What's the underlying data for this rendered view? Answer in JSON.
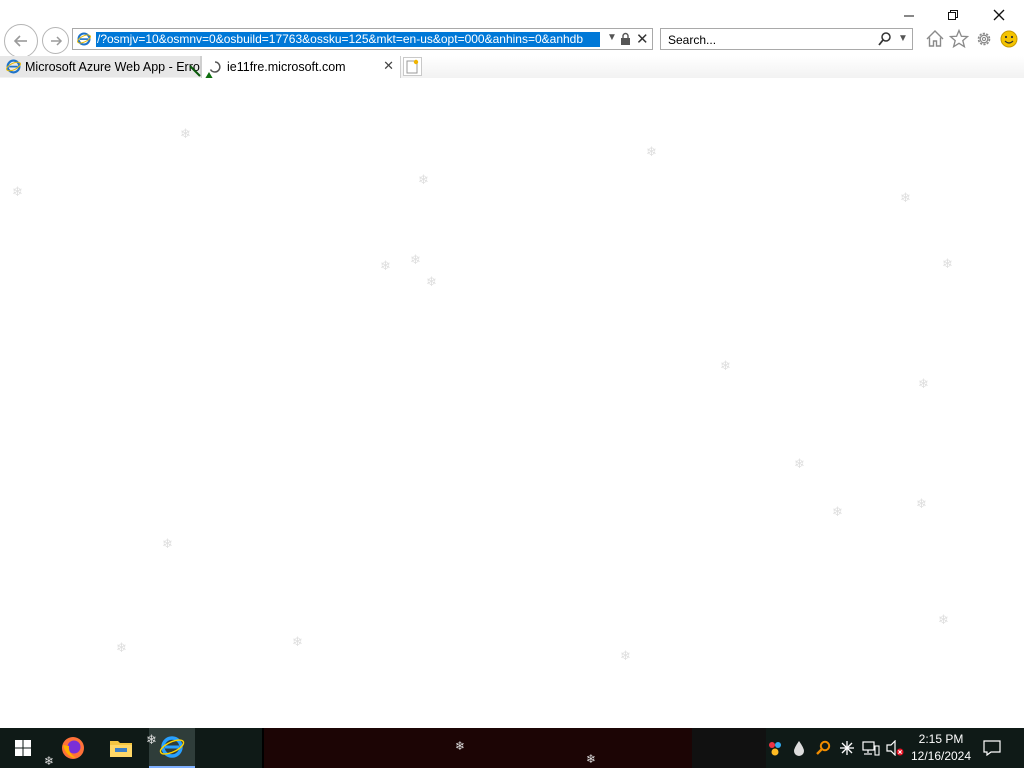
{
  "address_bar": {
    "url": "/?osmjv=10&osmnv=0&osbuild=17763&ossku=125&mkt=en-us&opt=000&anhins=0&anhdb"
  },
  "search": {
    "placeholder": "Search..."
  },
  "tabs": [
    {
      "label": "Microsoft Azure Web App - Error",
      "icon": "ie-page-icon",
      "active": false
    },
    {
      "label": "ie11fre.microsoft.com",
      "icon": "loading-icon",
      "active": true
    }
  ],
  "toolbar_icons": [
    "home-icon",
    "favorites-star-icon",
    "tools-gear-icon",
    "feedback-smiley-icon"
  ],
  "window_controls": [
    "minimize",
    "restore",
    "close"
  ],
  "taskbar": {
    "pinned": [
      "start",
      "firefox",
      "file-explorer",
      "internet-explorer"
    ],
    "tray_icons": [
      "people-icon",
      "droplet-icon",
      "search-tray-icon",
      "asterisk-icon",
      "network-icon",
      "volume-muted-icon"
    ],
    "time": "2:15 PM",
    "date": "12/16/2024"
  },
  "colors": {
    "selection": "#0078d7",
    "taskbar": "#0f1a17"
  }
}
